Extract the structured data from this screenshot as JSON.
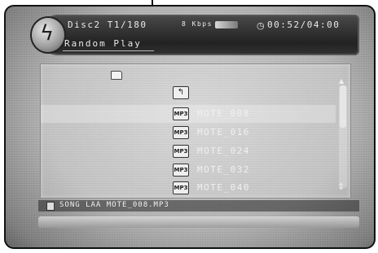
{
  "status_bar": {
    "disc_track": "Disc2 T1/180",
    "bitrate": "8 Kbps",
    "time": "00:52/04:00",
    "play_mode": "Random Play"
  },
  "browser": {
    "folder_path": "",
    "files": [
      {
        "name": "MOTE_008",
        "icon": "MP3",
        "selected": true
      },
      {
        "name": "MOTE_016",
        "icon": "MP3",
        "selected": false
      },
      {
        "name": "MOTE_024",
        "icon": "MP3",
        "selected": false
      },
      {
        "name": "MOTE_032",
        "icon": "MP3",
        "selected": false
      },
      {
        "name": "MOTE_040",
        "icon": "MP3",
        "selected": false
      }
    ]
  },
  "bottom": {
    "current_file": "SONG LAA MOTE_008.MP3"
  },
  "icons": [
    "lightning-disc-icon",
    "clock-icon",
    "folder-icon",
    "up-folder-icon",
    "mp3-file-icon",
    "scroll-arrow-icon"
  ]
}
